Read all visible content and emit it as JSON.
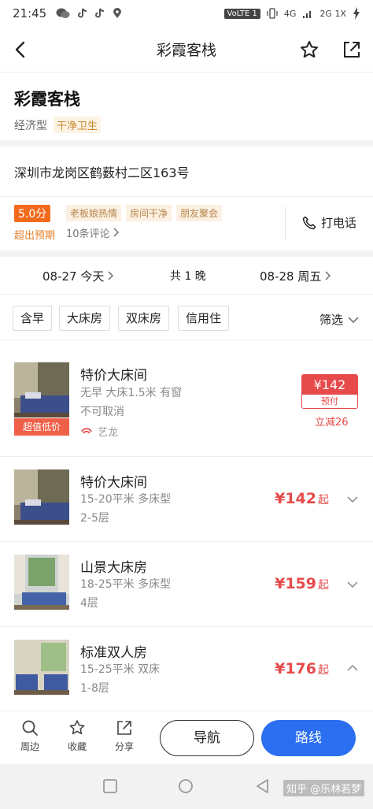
{
  "status_bar": {
    "time": "21:45",
    "volte": "VoLTE 1",
    "network": "4G",
    "network2": "2G 1X"
  },
  "nav": {
    "title": "彩霞客栈"
  },
  "hotel": {
    "name": "彩霞客栈",
    "type": "经济型",
    "tag": "干净卫生",
    "address": "深圳市龙岗区鹤薮村二区163号",
    "score": "5.0分",
    "rating_tags": [
      "老板娘热情",
      "房间干净",
      "朋友聚会"
    ],
    "exceed_label": "超出预期",
    "reviews": "10条评论",
    "phone_label": "打电话"
  },
  "dates": {
    "checkin": "08-27 今天",
    "nights": "共 1 晚",
    "checkout": "08-28 周五"
  },
  "filters": {
    "items": [
      "含早",
      "大床房",
      "双床房",
      "信用住"
    ],
    "screening": "筛选"
  },
  "rooms": [
    {
      "name": "特价大床间",
      "line1": "无早 大床1.5米 有窗",
      "line2": "不可取消",
      "badge": "超值低价",
      "supplier": "艺龙",
      "price": "¥142",
      "book_label": "预付",
      "discount": "立减26"
    },
    {
      "name": "特价大床间",
      "line1": "15-20平米 多床型",
      "line2": "2-5层",
      "price": "¥142",
      "suffix": "起"
    },
    {
      "name": "山景大床房",
      "line1": "18-25平米 多床型",
      "line2": "4层",
      "price": "¥159",
      "suffix": "起"
    },
    {
      "name": "标准双人房",
      "line1": "15-25平米 双床",
      "line2": "1-8层",
      "price": "¥176",
      "suffix": "起"
    }
  ],
  "bottom": {
    "nearby": "周边",
    "favorite": "收藏",
    "share": "分享",
    "navigate": "导航",
    "route": "路线"
  },
  "watermark": "知乎 @乐林若梦",
  "colors": {
    "accent_red": "#e64a4a",
    "accent_orange": "#f26b1d",
    "primary_blue": "#2b6ff0"
  }
}
